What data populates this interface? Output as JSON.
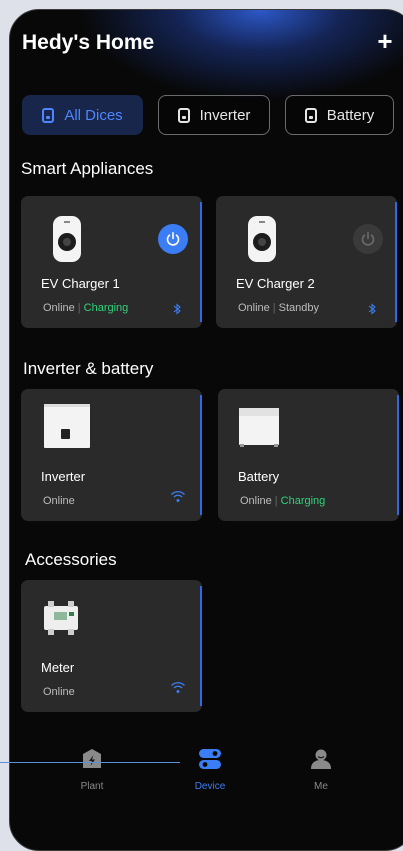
{
  "header": {
    "title": "Hedy's Home",
    "add_label": "+"
  },
  "tabs": [
    {
      "label": "All Dices",
      "active": true
    },
    {
      "label": "Inverter",
      "active": false
    },
    {
      "label": "Battery",
      "active": false
    }
  ],
  "sections": {
    "smart": "Smart Appliances",
    "inverter_battery": "Inverter & battery",
    "accessories": "Accessories"
  },
  "devices": {
    "ev1": {
      "name": "EV Charger 1",
      "online": "Online",
      "state": "Charging",
      "power": "on"
    },
    "ev2": {
      "name": "EV Charger 2",
      "online": "Online",
      "state": "Standby",
      "power": "off"
    },
    "inverter": {
      "name": "Inverter",
      "online": "Online"
    },
    "battery": {
      "name": "Battery",
      "online": "Online",
      "state": "Charging"
    },
    "meter": {
      "name": "Meter",
      "online": "Online"
    }
  },
  "bottom_nav": [
    {
      "label": "Plant",
      "icon": "plant-icon",
      "active": false
    },
    {
      "label": "Device",
      "icon": "device-icon",
      "active": true
    },
    {
      "label": "Me",
      "icon": "me-icon",
      "active": false
    }
  ],
  "colors": {
    "accent": "#3b7df5",
    "charging": "#2fd37a",
    "card": "#2a2a2a",
    "background": "#080808"
  }
}
